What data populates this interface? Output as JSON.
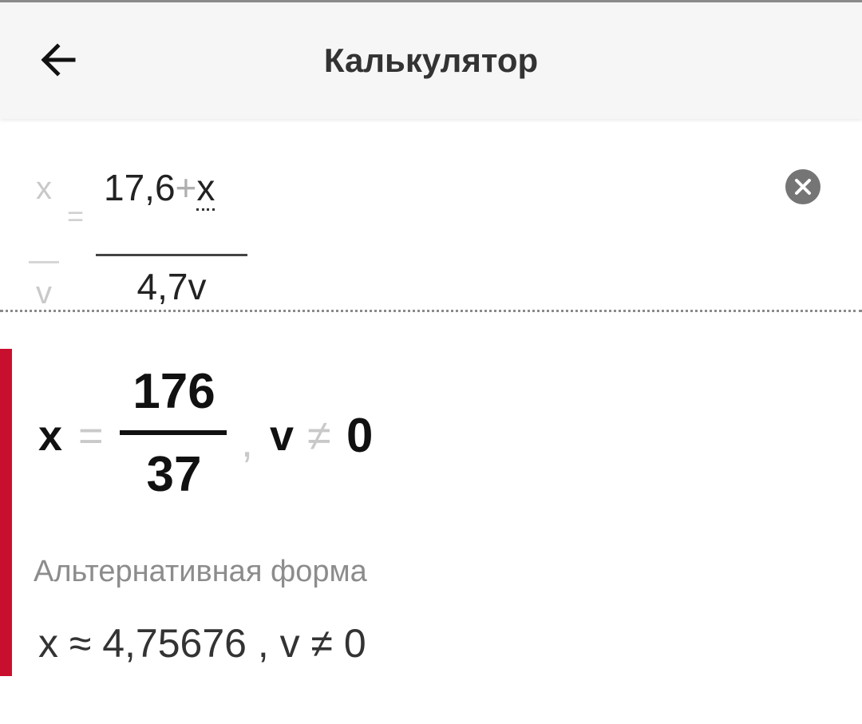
{
  "header": {
    "back_icon": "arrow-left-icon",
    "title": "Калькулятор"
  },
  "expression": {
    "ghost_numerator": "x",
    "ghost_denominator": "v",
    "ghost_equals": "=",
    "numerator_value": "17,6",
    "numerator_plus": "+",
    "numerator_var": "x",
    "denominator": "4,7v",
    "clear_icon": "close-circle-icon"
  },
  "result": {
    "variable": "x",
    "equals": "=",
    "numerator": "176",
    "denominator": "37",
    "comma": ",",
    "condition_var": "v",
    "condition_op": "≠",
    "condition_value": "0",
    "alt_label": "Альтернативная форма",
    "alt_value": "x ≈ 4,75676 , v ≠ 0"
  },
  "colors": {
    "accent": "#c8102e",
    "appbar_bg": "#f6f6f6",
    "muted": "#c9c9c9"
  }
}
